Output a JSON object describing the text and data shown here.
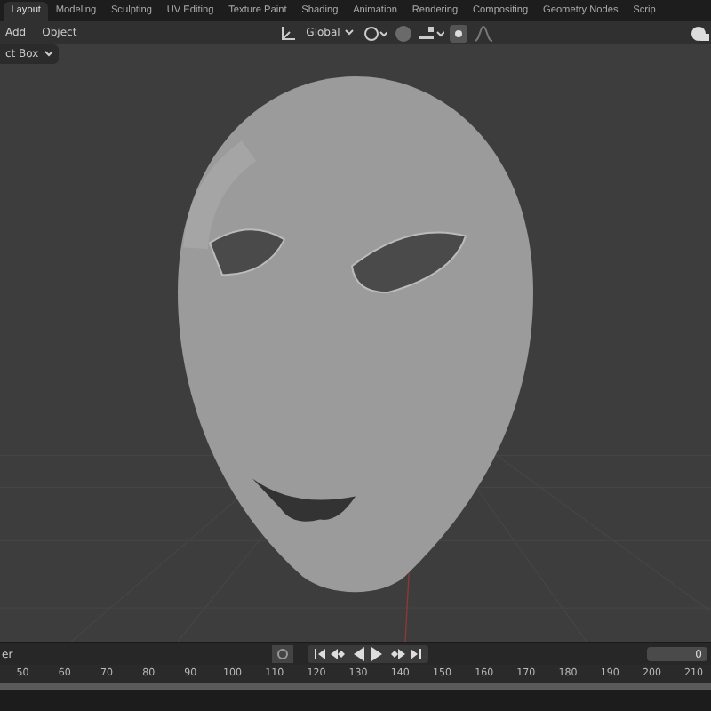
{
  "workspace_tabs": [
    {
      "label": "Layout",
      "selected": true
    },
    {
      "label": "Modeling",
      "selected": false
    },
    {
      "label": "Sculpting",
      "selected": false
    },
    {
      "label": "UV Editing",
      "selected": false
    },
    {
      "label": "Texture Paint",
      "selected": false
    },
    {
      "label": "Shading",
      "selected": false
    },
    {
      "label": "Animation",
      "selected": false
    },
    {
      "label": "Rendering",
      "selected": false
    },
    {
      "label": "Compositing",
      "selected": false
    },
    {
      "label": "Geometry Nodes",
      "selected": false
    },
    {
      "label": "Scrip",
      "selected": false
    }
  ],
  "viewport_header": {
    "menus": [
      "Add",
      "Object"
    ],
    "orientation": "Global"
  },
  "select_mode": "ct Box",
  "timeline": {
    "label": "er",
    "frame": "0",
    "ruler": [
      "50",
      "60",
      "70",
      "80",
      "90",
      "100",
      "110",
      "120",
      "130",
      "140",
      "150",
      "160",
      "170",
      "180",
      "190",
      "200",
      "210"
    ]
  }
}
